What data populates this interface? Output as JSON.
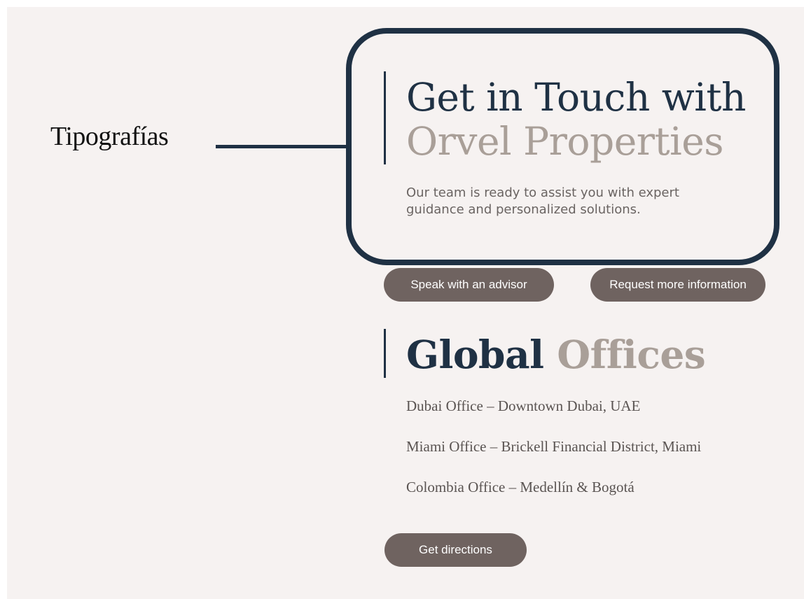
{
  "annotation": {
    "label": "Tipografías"
  },
  "hero": {
    "title_line1": "Get in Touch with",
    "title_line2": "Orvel Properties",
    "description": "Our team is ready to assist you with expert guidance and personalized solutions."
  },
  "buttons": {
    "advisor": "Speak with an advisor",
    "info": "Request more information",
    "directions": "Get directions"
  },
  "offices": {
    "title_dark": "Global",
    "title_muted": "Offices",
    "items": [
      "Dubai Office – Downtown Dubai, UAE",
      "Miami Office – Brickell Financial District, Miami",
      "Colombia Office – Medellín & Bogotá"
    ]
  },
  "colors": {
    "primary_navy": "#1f3144",
    "muted_taupe": "#a99f98",
    "button_brown": "#6f6360",
    "background": "#f6f2f1"
  }
}
